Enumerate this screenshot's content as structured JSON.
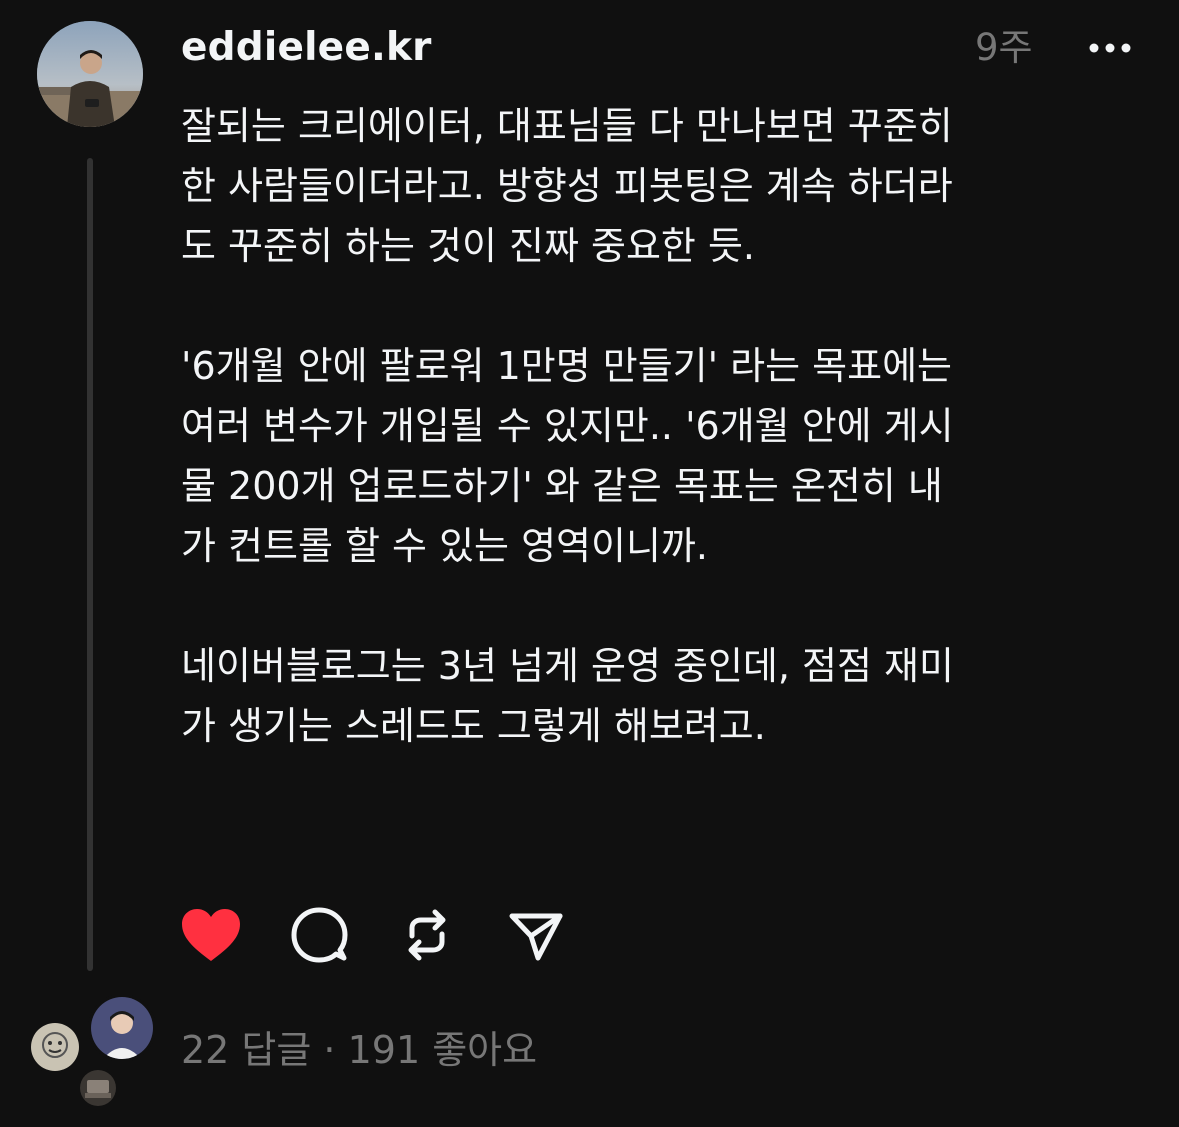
{
  "post": {
    "username": "eddielee.kr",
    "timestamp": "9주",
    "paragraphs": [
      "잘되는 크리에이터, 대표님들 다 만나보면 꾸준히\n한 사람들이더라고. 방향성 피봇팅은 계속 하더라\n도 꾸준히 하는 것이 진짜 중요한 듯.",
      "'6개월 안에 팔로워 1만명 만들기' 라는 목표에는\n여러 변수가 개입될 수 있지만.. '6개월 안에 게시\n물 200개 업로드하기' 와 같은 목표는 온전히 내\n가 컨트롤 할 수 있는 영역이니까.",
      "네이버블로그는 3년 넘게 운영 중인데, 점점 재미\n가 생기는 스레드도 그렇게 해보려고."
    ],
    "liked": true
  },
  "actions": {
    "like_icon": "heart-filled-icon",
    "comment_icon": "comment-bubble-icon",
    "repost_icon": "repost-icon",
    "share_icon": "send-icon"
  },
  "stats": {
    "text": "22 답글 · 191 좋아요"
  },
  "colors": {
    "background": "#101010",
    "text_primary": "#f3f5f7",
    "text_secondary": "#777777",
    "like_red": "#ff3040",
    "thread_line": "#323232"
  }
}
